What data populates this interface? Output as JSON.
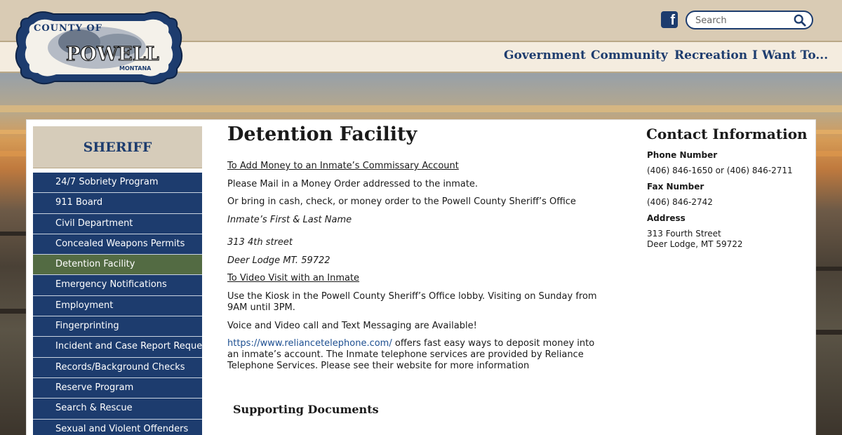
{
  "header": {
    "search_placeholder": "Search",
    "nav": [
      "Government",
      "Community",
      "Recreation",
      "I Want To..."
    ]
  },
  "sidebar": {
    "title": "SHERIFF",
    "items": [
      {
        "label": "24/7 Sobriety Program"
      },
      {
        "label": "911 Board"
      },
      {
        "label": "Civil Department"
      },
      {
        "label": "Concealed Weapons Permits"
      },
      {
        "label": "Detention Facility",
        "active": true
      },
      {
        "label": "Emergency Notifications"
      },
      {
        "label": "Employment"
      },
      {
        "label": "Fingerprinting"
      },
      {
        "label": "Incident and Case Report Request"
      },
      {
        "label": "Records/Background Checks"
      },
      {
        "label": "Reserve Program"
      },
      {
        "label": "Search & Rescue"
      },
      {
        "label": "Sexual and Violent Offenders"
      }
    ]
  },
  "main": {
    "title": "Detention Facility",
    "add_money_heading": "To Add Money to an Inmate’s Commissary Account",
    "mail_text": "Please Mail in a Money Order addressed to the inmate.",
    "bring_text": "Or bring in cash, check, or money order to the Powell County Sheriff’s Office",
    "name_line": "Inmate’s First & Last Name",
    "street_line": "313 4th street",
    "city_line": "Deer Lodge MT. 59722",
    "video_heading": "To Video Visit with an Inmate",
    "kiosk_text": "Use the Kiosk in the Powell County Sheriff’s Office lobby. Visiting on Sunday from 9AM until 3PM.",
    "voice_text": "Voice and Video call and Text Messaging are Available!",
    "reliance_link": "https://www.reliancetelephone.com/",
    "reliance_text": " offers fast easy ways to deposit money into an inmate’s account. The Inmate telephone services are provided by Reliance Telephone Services. Please see their website for more information",
    "supporting_docs": "Supporting Documents"
  },
  "contact": {
    "title": "Contact Information",
    "phone_label": "Phone Number",
    "phone_value": "(406) 846-1650 or (406) 846-2711",
    "fax_label": "Fax Number",
    "fax_value": "(406) 846-2742",
    "address_label": "Address",
    "address_line1": "313 Fourth Street",
    "address_line2": "Deer Lodge, MT 59722"
  },
  "logo": {
    "line1": "COUNTY OF",
    "line2": "POWELL",
    "line3": "MONTANA"
  },
  "colors": {
    "brand_navy": "#1d3c6e",
    "active_green": "#536b43",
    "header_tan": "#d9cbb4"
  },
  "icons": {
    "facebook": "facebook-icon",
    "search": "search-icon"
  }
}
